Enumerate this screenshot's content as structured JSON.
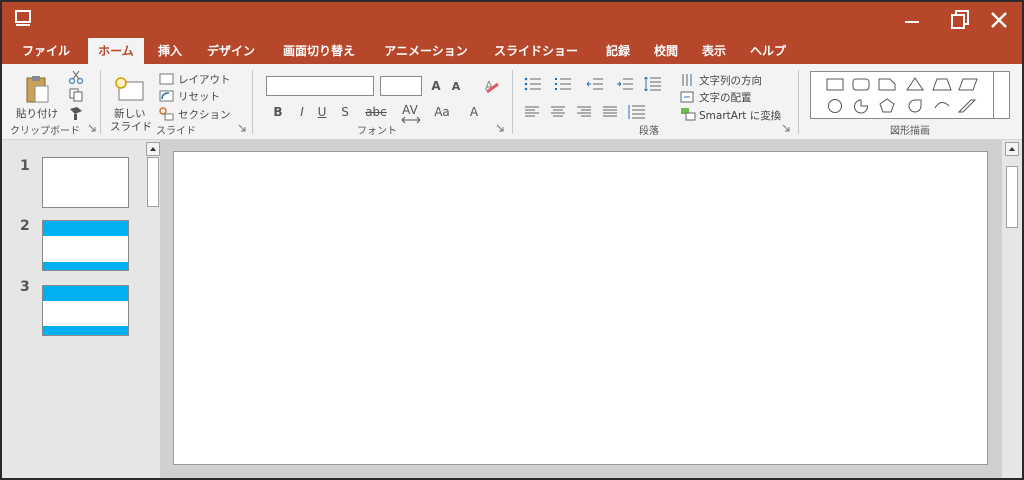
{
  "tabs": [
    "ファイル",
    "ホーム",
    "挿入",
    "デザイン",
    "画面切り替え",
    "アニメーション",
    "スライドショー",
    "記録",
    "校閲",
    "表示",
    "ヘルプ"
  ],
  "active_tab": "ホーム",
  "ribbon": {
    "clipboard": {
      "paste_label": "貼り付け",
      "group_label": "クリップボード"
    },
    "slides": {
      "new_slide_line1": "新しい",
      "new_slide_line2": "スライド",
      "layout_label": "レイアウト",
      "reset_label": "リセット",
      "section_label": "セクション",
      "group_label": "スライド"
    },
    "font": {
      "font_name_value": "",
      "font_size_value": "",
      "grow_label": "A",
      "shrink_label": "A",
      "clear_label": "A",
      "bold_label": "B",
      "italic_label": "I",
      "underline_label": "U",
      "shadow_label": "S",
      "strike_label": "abc",
      "spacing_label": "AV",
      "case_label": "Aa",
      "color_label": "A",
      "group_label": "フォント"
    },
    "paragraph": {
      "text_direction_label": "文字列の方向",
      "align_text_label": "文字の配置",
      "smartart_label": "SmartArt に変換",
      "group_label": "段落"
    },
    "drawing": {
      "group_label": "図形描画"
    }
  },
  "thumbnails": [
    {
      "number": "1",
      "style": "blank"
    },
    {
      "number": "2",
      "style": "bands"
    },
    {
      "number": "3",
      "style": "bands"
    }
  ],
  "colors": {
    "accent": "#b7472a",
    "thumb_band": "#00b0f0"
  }
}
